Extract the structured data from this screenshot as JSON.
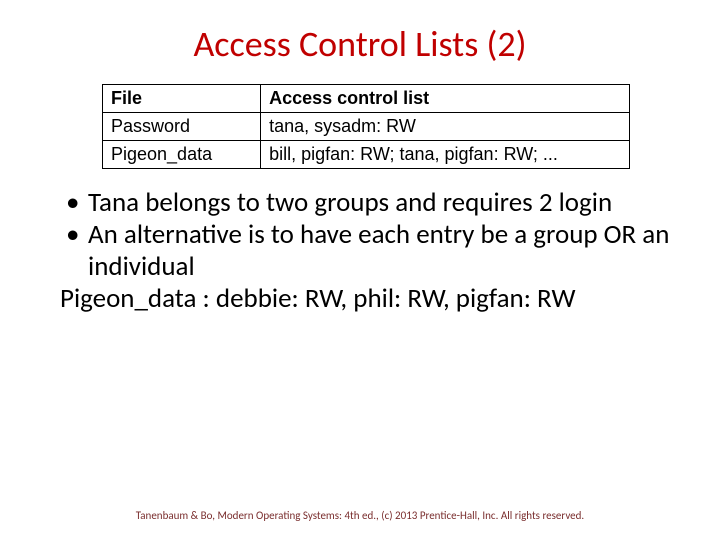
{
  "title": "Access Control Lists (2)",
  "table": {
    "headers": {
      "file": "File",
      "acl": "Access control list"
    },
    "rows": [
      {
        "file": "Password",
        "acl": "tana, sysadm: RW"
      },
      {
        "file": "Pigeon_data",
        "acl": "bill, pigfan: RW;  tana, pigfan: RW; ..."
      }
    ]
  },
  "bullets": [
    "Tana belongs to two groups and requires 2 login",
    "An alternative is to have each entry be a group OR an individual"
  ],
  "example_line": "Pigeon_data : debbie: RW, phil: RW, pigfan: RW",
  "footer": "Tanenbaum & Bo, Modern Operating Systems: 4th ed., (c) 2013 Prentice-Hall, Inc. All rights reserved."
}
